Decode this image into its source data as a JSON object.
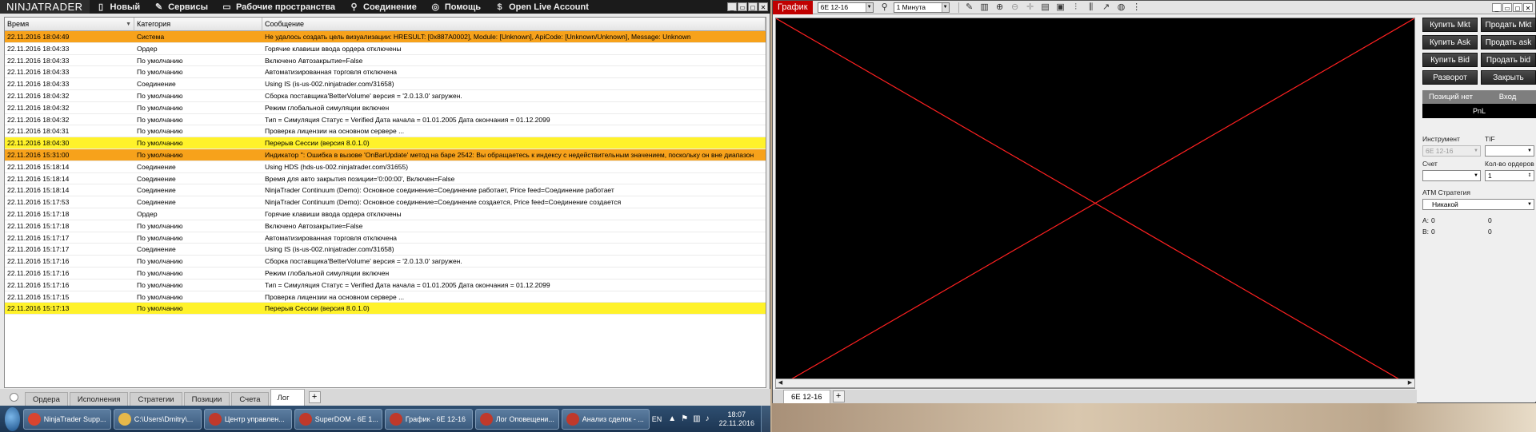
{
  "control_center": {
    "logo": "NINJATRADER",
    "menu": [
      {
        "icon": "document-icon",
        "glyph": "▯",
        "label": "Новый"
      },
      {
        "icon": "wrench-icon",
        "glyph": "✎",
        "label": "Сервисы"
      },
      {
        "icon": "workspace-icon",
        "glyph": "▭",
        "label": "Рабочие пространства"
      },
      {
        "icon": "plug-icon",
        "glyph": "⚲",
        "label": "Соединение"
      },
      {
        "icon": "lifebuoy-icon",
        "glyph": "◎",
        "label": "Помощь"
      },
      {
        "icon": "dollar-icon",
        "glyph": "$",
        "label": "Open Live Account"
      }
    ],
    "window_buttons": [
      "_",
      "▭",
      "◻",
      "✕"
    ],
    "log": {
      "headers": {
        "time": "Время",
        "category": "Категория",
        "message": "Сообщение"
      },
      "rows": [
        {
          "time": "22.11.2016 18:04:49",
          "category": "Система",
          "message": "Не удалось создать цель визуализации: HRESULT: [0x887A0002], Module: [Unknown], ApiCode: [Unknown/Unknown], Message: Unknown",
          "highlight": "orange"
        },
        {
          "time": "22.11.2016 18:04:33",
          "category": "Ордер",
          "message": "Горячие клавиши ввода ордера отключены",
          "highlight": ""
        },
        {
          "time": "22.11.2016 18:04:33",
          "category": "По умолчанию",
          "message": "Включено Автозакрытие=False",
          "highlight": ""
        },
        {
          "time": "22.11.2016 18:04:33",
          "category": "По умолчанию",
          "message": "Автоматизированная торговля отключена",
          "highlight": ""
        },
        {
          "time": "22.11.2016 18:04:33",
          "category": "Соединение",
          "message": "Using IS (is-us-002.ninjatrader.com/31658)",
          "highlight": ""
        },
        {
          "time": "22.11.2016 18:04:32",
          "category": "По умолчанию",
          "message": "Сборка поставщика'BetterVolume' версия = '2.0.13.0' загружен.",
          "highlight": ""
        },
        {
          "time": "22.11.2016 18:04:32",
          "category": "По умолчанию",
          "message": "Режим глобальной симуляции включен",
          "highlight": ""
        },
        {
          "time": "22.11.2016 18:04:32",
          "category": "По умолчанию",
          "message": "Тип = Симуляция Статус = Verified Дата начала = 01.01.2005 Дата окончания = 01.12.2099",
          "highlight": ""
        },
        {
          "time": "22.11.2016 18:04:31",
          "category": "По умолчанию",
          "message": "Проверка лицензии на основном сервере ...",
          "highlight": ""
        },
        {
          "time": "22.11.2016 18:04:30",
          "category": "По умолчанию",
          "message": "Перерыв Сессии (версия 8.0.1.0)",
          "highlight": "yellow"
        },
        {
          "time": "22.11.2016 15:31:00",
          "category": "По умолчанию",
          "message": "Индикатор '': Ошибка в вызове 'OnBarUpdate' метод на баре 2542: Вы обращаетесь к индексу с недействительным значением, поскольку он вне диапазон",
          "highlight": "orange"
        },
        {
          "time": "22.11.2016 15:18:14",
          "category": "Соединение",
          "message": "Using HDS (hds-us-002.ninjatrader.com/31655)",
          "highlight": ""
        },
        {
          "time": "22.11.2016 15:18:14",
          "category": "Соединение",
          "message": "Время для авто закрытия позиции='0:00:00', Включен=False",
          "highlight": ""
        },
        {
          "time": "22.11.2016 15:18:14",
          "category": "Соединение",
          "message": "NinjaTrader Continuum (Demo): Основное соединение=Соединение работает, Price feed=Соединение работает",
          "highlight": ""
        },
        {
          "time": "22.11.2016 15:17:53",
          "category": "Соединение",
          "message": "NinjaTrader Continuum (Demo): Основное соединение=Соединение создается, Price feed=Соединение создается",
          "highlight": ""
        },
        {
          "time": "22.11.2016 15:17:18",
          "category": "Ордер",
          "message": "Горячие клавиши ввода ордера отключены",
          "highlight": ""
        },
        {
          "time": "22.11.2016 15:17:18",
          "category": "По умолчанию",
          "message": "Включено Автозакрытие=False",
          "highlight": ""
        },
        {
          "time": "22.11.2016 15:17:17",
          "category": "По умолчанию",
          "message": "Автоматизированная торговля отключена",
          "highlight": ""
        },
        {
          "time": "22.11.2016 15:17:17",
          "category": "Соединение",
          "message": "Using IS (is-us-002.ninjatrader.com/31658)",
          "highlight": ""
        },
        {
          "time": "22.11.2016 15:17:16",
          "category": "По умолчанию",
          "message": "Сборка поставщика'BetterVolume' версия = '2.0.13.0' загружен.",
          "highlight": ""
        },
        {
          "time": "22.11.2016 15:17:16",
          "category": "По умолчанию",
          "message": "Режим глобальной симуляции включен",
          "highlight": ""
        },
        {
          "time": "22.11.2016 15:17:16",
          "category": "По умолчанию",
          "message": "Тип = Симуляция Статус = Verified Дата начала = 01.01.2005 Дата окончания = 01.12.2099",
          "highlight": ""
        },
        {
          "time": "22.11.2016 15:17:15",
          "category": "По умолчанию",
          "message": "Проверка лицензии на основном сервере ...",
          "highlight": ""
        },
        {
          "time": "22.11.2016 15:17:13",
          "category": "По умолчанию",
          "message": "Перерыв Сессии (версия 8.0.1.0)",
          "highlight": "yellow"
        }
      ]
    },
    "tabs": [
      "Ордера",
      "Исполнения",
      "Стратегии",
      "Позиции",
      "Счета",
      "Лог"
    ],
    "active_tab": "Лог"
  },
  "taskbar": {
    "items": [
      {
        "icon": "chrome-icon",
        "color": "#d9442f",
        "label": "NinjaTrader Supp..."
      },
      {
        "icon": "folder-icon",
        "color": "#e6b84a",
        "label": "C:\\Users\\Dmitry\\..."
      },
      {
        "icon": "ninjatrader-icon",
        "color": "#c0392b",
        "label": "Центр управлен..."
      },
      {
        "icon": "ninjatrader-icon",
        "color": "#c0392b",
        "label": "SuperDOM - 6E 1..."
      },
      {
        "icon": "ninjatrader-icon",
        "color": "#c0392b",
        "label": "График - 6E 12-16"
      },
      {
        "icon": "ninjatrader-icon",
        "color": "#c0392b",
        "label": "Лог Оповещени..."
      },
      {
        "icon": "ninjatrader-icon",
        "color": "#c0392b",
        "label": "Анализ сделок - ..."
      }
    ],
    "language": "EN",
    "time": "18:07",
    "date": "22.11.2016"
  },
  "chart_window": {
    "title": "График",
    "instrument": "6E 12-16",
    "interval": "1 Минута",
    "tab": "6E 12-16",
    "window_buttons": [
      "_",
      "▭",
      "◻",
      "✕"
    ],
    "cross_color": "#ff2020"
  },
  "trader": {
    "buttons": [
      "Купить Mkt",
      "Продать Mkt",
      "Купить Ask",
      "Продать ask",
      "Купить Bid",
      "Продать bid",
      "Разворот",
      "Закрыть"
    ],
    "position_label": "Позиций нет",
    "entry_label": "Вход",
    "pnl_label": "PnL",
    "instrument_label": "Инструмент",
    "instrument_value": "6E 12-16",
    "tif_label": "TIF",
    "tif_value": "",
    "account_label": "Счет",
    "account_value": "",
    "qty_label": "Кол-во ордеров",
    "qty_value": "1",
    "atm_label": "ATM Стратегия",
    "atm_value": "Никакой",
    "a_label": "A:",
    "a_value": "0",
    "a_value2": "0",
    "b_label": "B:",
    "b_value": "0",
    "b_value2": "0"
  }
}
